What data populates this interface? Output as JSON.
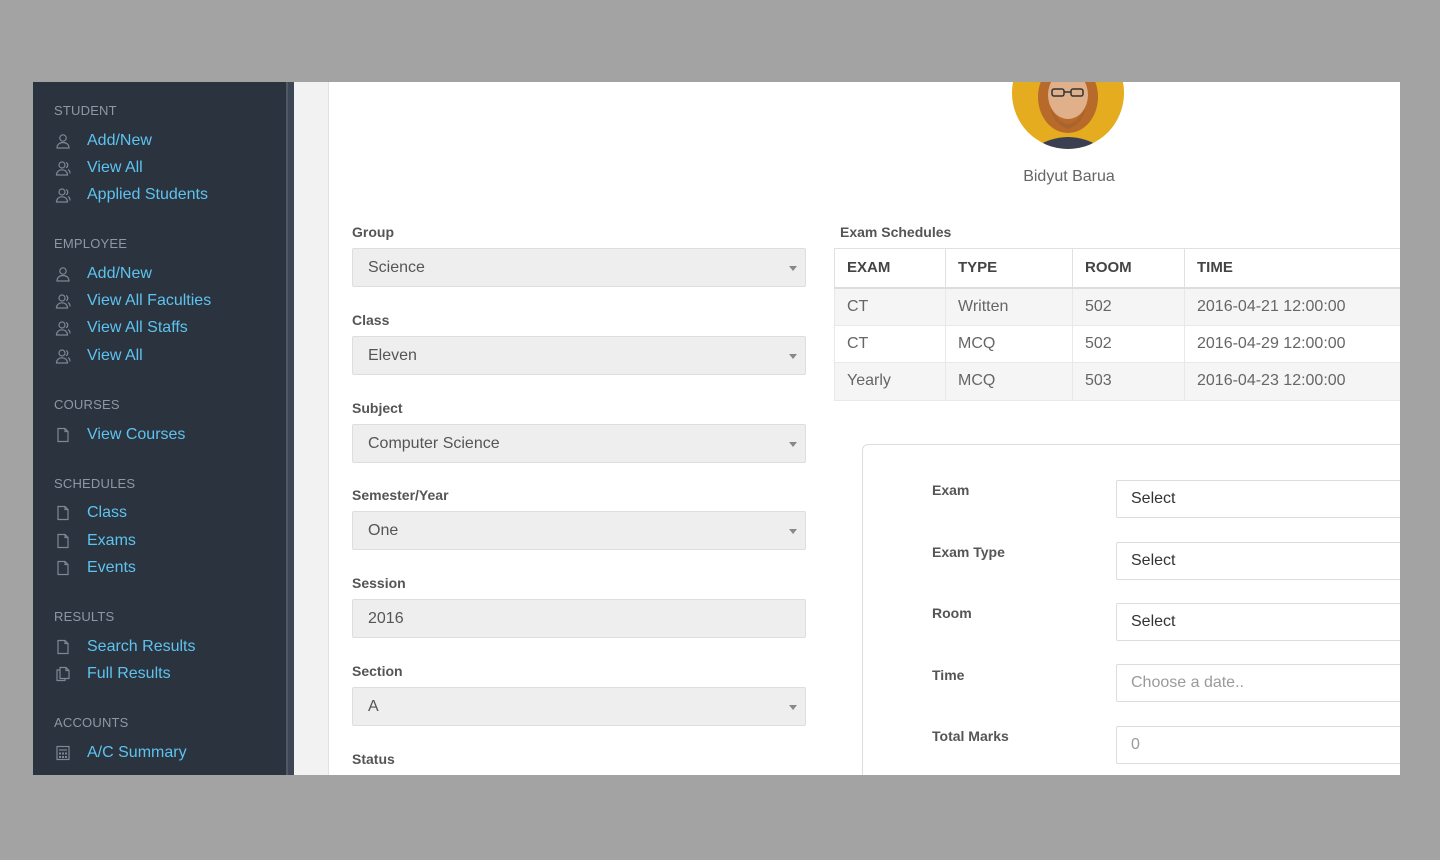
{
  "sidebar": {
    "sections": [
      {
        "title": "STUDENT",
        "items": [
          {
            "label": "Add/New",
            "icon": "user-icon"
          },
          {
            "label": "View All",
            "icon": "users-icon"
          },
          {
            "label": "Applied Students",
            "icon": "users-icon"
          }
        ]
      },
      {
        "title": "EMPLOYEE",
        "items": [
          {
            "label": "Add/New",
            "icon": "user-icon"
          },
          {
            "label": "View All Faculties",
            "icon": "users-icon"
          },
          {
            "label": "View All Staffs",
            "icon": "users-icon"
          },
          {
            "label": "View All",
            "icon": "users-icon"
          }
        ]
      },
      {
        "title": "COURSES",
        "items": [
          {
            "label": "View Courses",
            "icon": "document-icon"
          }
        ]
      },
      {
        "title": "SCHEDULES",
        "items": [
          {
            "label": "Class",
            "icon": "document-icon"
          },
          {
            "label": "Exams",
            "icon": "document-icon"
          },
          {
            "label": "Events",
            "icon": "document-icon"
          }
        ]
      },
      {
        "title": "RESULTS",
        "items": [
          {
            "label": "Search Results",
            "icon": "document-icon"
          },
          {
            "label": "Full Results",
            "icon": "documents-icon"
          }
        ]
      },
      {
        "title": "ACCOUNTS",
        "items": [
          {
            "label": "A/C Summary",
            "icon": "calculator-icon"
          }
        ]
      }
    ]
  },
  "profile": {
    "name": "Bidyut Barua"
  },
  "form": {
    "group": {
      "label": "Group",
      "value": "Science"
    },
    "class": {
      "label": "Class",
      "value": "Eleven"
    },
    "subject": {
      "label": "Subject",
      "value": "Computer Science"
    },
    "semester": {
      "label": "Semester/Year",
      "value": "One"
    },
    "session": {
      "label": "Session",
      "value": "2016"
    },
    "section": {
      "label": "Section",
      "value": "A"
    },
    "status": {
      "label": "Status"
    }
  },
  "schedules": {
    "title": "Exam Schedules",
    "headers": [
      "EXAM",
      "TYPE",
      "ROOM",
      "TIME"
    ],
    "rows": [
      [
        "CT",
        "Written",
        "502",
        "2016-04-21 12:00:00"
      ],
      [
        "CT",
        "MCQ",
        "502",
        "2016-04-29 12:00:00"
      ],
      [
        "Yearly",
        "MCQ",
        "503",
        "2016-04-23 12:00:00"
      ]
    ]
  },
  "exam_form": {
    "exam": {
      "label": "Exam",
      "value": "Select"
    },
    "exam_type": {
      "label": "Exam Type",
      "value": "Select"
    },
    "room": {
      "label": "Room",
      "value": "Select"
    },
    "time": {
      "label": "Time",
      "placeholder": "Choose a date.."
    },
    "total_marks": {
      "label": "Total Marks",
      "placeholder": "0"
    }
  },
  "colors": {
    "sidebar_bg": "#2b333e",
    "link": "#5dc3f0",
    "section_title": "#8e98a5"
  }
}
